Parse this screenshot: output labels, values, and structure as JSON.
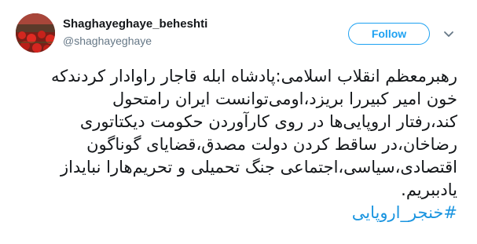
{
  "user": {
    "display_name": "Shaghayeghaye_beheshti",
    "handle": "@shaghayeghaye",
    "avatar_icon": "avatar-poppy-field"
  },
  "actions": {
    "follow_label": "Follow",
    "more_icon": "chevron-down-icon"
  },
  "tweet": {
    "lines": [
      "رهبرمعظم انقلاب اسلامی:پادشاه ابله قاجار راوادار کردندکه",
      "خون امیر کبیررا بریزد،اومی‌توانست ایران رامتحول",
      "کند،رفتار اروپایی‌ها در روی کارآوردن حکومت دیکتاتوری",
      "رضاخان،در ساقط کردن دولت مصدق،قضایای گوناگون",
      "اقتصادی،سیاسی،اجتماعی جنگ تحمیلی و تحریم‌هارا نبایداز",
      "یادببریم."
    ],
    "hashtag": "#خنجر_اروپایی"
  },
  "colors": {
    "accent": "#1da1f2",
    "hashtag": "#1b95e0",
    "text": "#14171a",
    "muted": "#657786"
  }
}
